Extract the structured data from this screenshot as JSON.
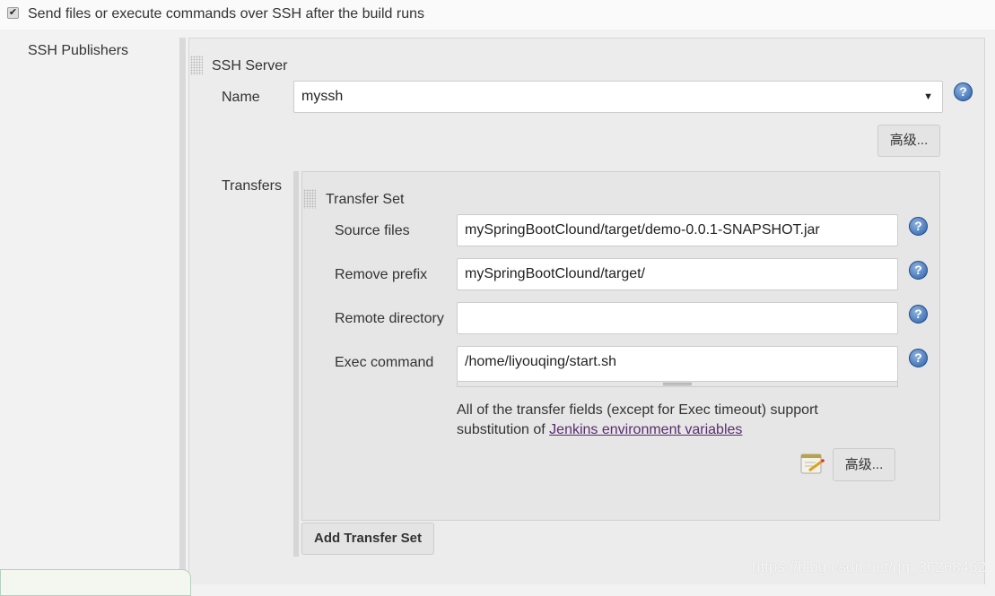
{
  "publish": {
    "checkbox_checked": true,
    "label": "Send files or execute commands over SSH after the build runs"
  },
  "sidebar": {
    "label": "SSH Publishers"
  },
  "ssh_server": {
    "title": "SSH Server",
    "name_label": "Name",
    "name_value": "myssh",
    "advanced_label": "高级...",
    "help_icon": "question-icon"
  },
  "transfers": {
    "label": "Transfers",
    "set_title": "Transfer Set",
    "fields": [
      {
        "label": "Source files",
        "value": "mySpringBootClound/target/demo-0.0.1-SNAPSHOT.jar"
      },
      {
        "label": "Remove prefix",
        "value": "mySpringBootClound/target/"
      },
      {
        "label": "Remote directory",
        "value": ""
      },
      {
        "label": "Exec command",
        "value": "/home/liyouqing/start.sh"
      }
    ],
    "note_text": "All of the transfer fields (except for Exec timeout) support",
    "note_text2": "substitution of ",
    "note_link": "Jenkins environment variables",
    "advanced_label": "高级...",
    "add_label": "Add Transfer Set"
  },
  "watermark": "https://blog.csdn.net/qq_36268452"
}
